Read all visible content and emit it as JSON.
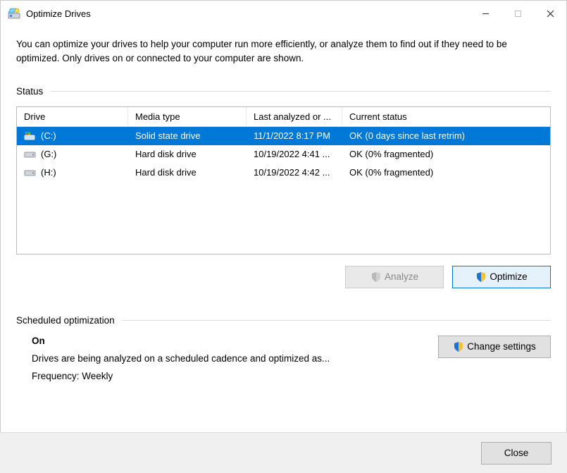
{
  "window": {
    "title": "Optimize Drives"
  },
  "description": "You can optimize your drives to help your computer run more efficiently, or analyze them to find out if they need to be optimized. Only drives on or connected to your computer are shown.",
  "status_label": "Status",
  "columns": {
    "drive": "Drive",
    "media": "Media type",
    "last": "Last analyzed or ...",
    "status": "Current status"
  },
  "drives": [
    {
      "name": "(C:)",
      "media": "Solid state drive",
      "last": "11/1/2022 8:17 PM",
      "status": "OK (0 days since last retrim)",
      "selected": true,
      "icon": "os"
    },
    {
      "name": "(G:)",
      "media": "Hard disk drive",
      "last": "10/19/2022 4:41 ...",
      "status": "OK (0% fragmented)",
      "selected": false,
      "icon": "hdd"
    },
    {
      "name": "(H:)",
      "media": "Hard disk drive",
      "last": "10/19/2022 4:42 ...",
      "status": "OK (0% fragmented)",
      "selected": false,
      "icon": "hdd"
    }
  ],
  "buttons": {
    "analyze": "Analyze",
    "optimize": "Optimize",
    "change_settings": "Change settings",
    "close": "Close"
  },
  "scheduled": {
    "label": "Scheduled optimization",
    "state": "On",
    "desc": "Drives are being analyzed on a scheduled cadence and optimized as...",
    "freq": "Frequency: Weekly"
  }
}
